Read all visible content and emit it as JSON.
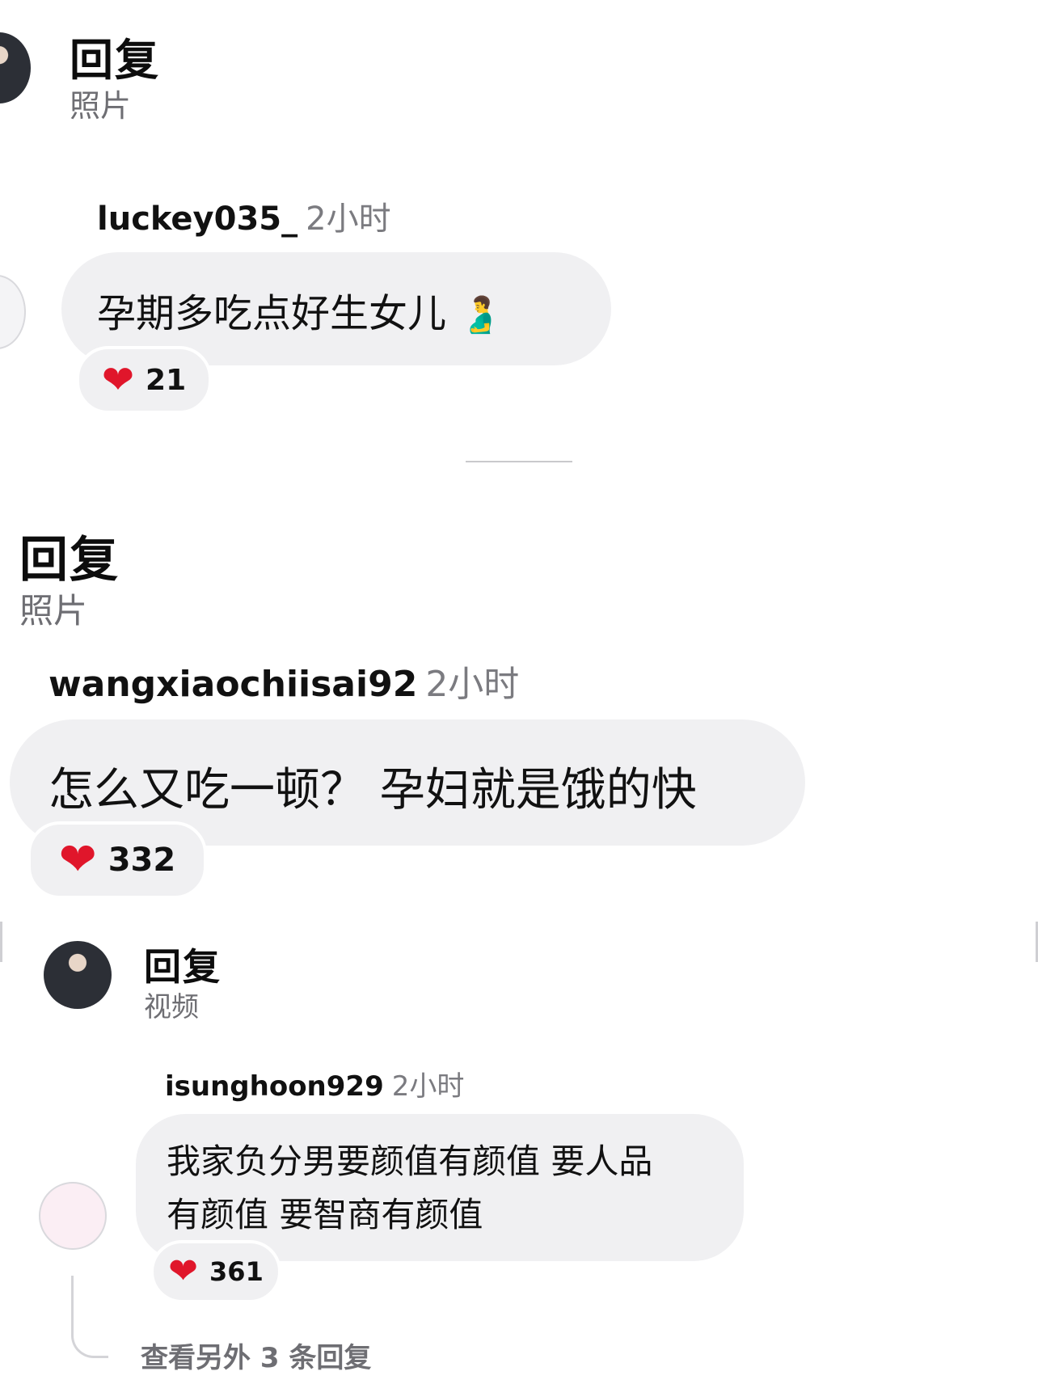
{
  "block1": {
    "reply_title": "回复",
    "reply_type": "照片",
    "username": "luckey035_",
    "time": "2小时",
    "comment": "孕期多吃点好生女儿",
    "comment_emoji": "🫃",
    "heart": "❤",
    "likes": "21"
  },
  "block2": {
    "reply_title": "回复",
    "reply_type": "照片",
    "username": "wangxiaochiisai92",
    "time": "2小时",
    "comment": "怎么又吃一顿？ 孕妇就是饿的快",
    "heart": "❤",
    "likes": "332"
  },
  "block3": {
    "reply_title": "回复",
    "reply_type": "视频",
    "username": "isunghoon929",
    "time": "2小时",
    "comment_line1": "我家负分男要颜值有颜值 要人品",
    "comment_line2": "有颜值 要智商有颜值",
    "heart": "❤",
    "likes": "361",
    "view_more": "查看另外 3 条回复"
  },
  "colors": {
    "bubble": "#f0f0f2",
    "heart": "#e0162b",
    "muted_text": "#6e6e73"
  }
}
